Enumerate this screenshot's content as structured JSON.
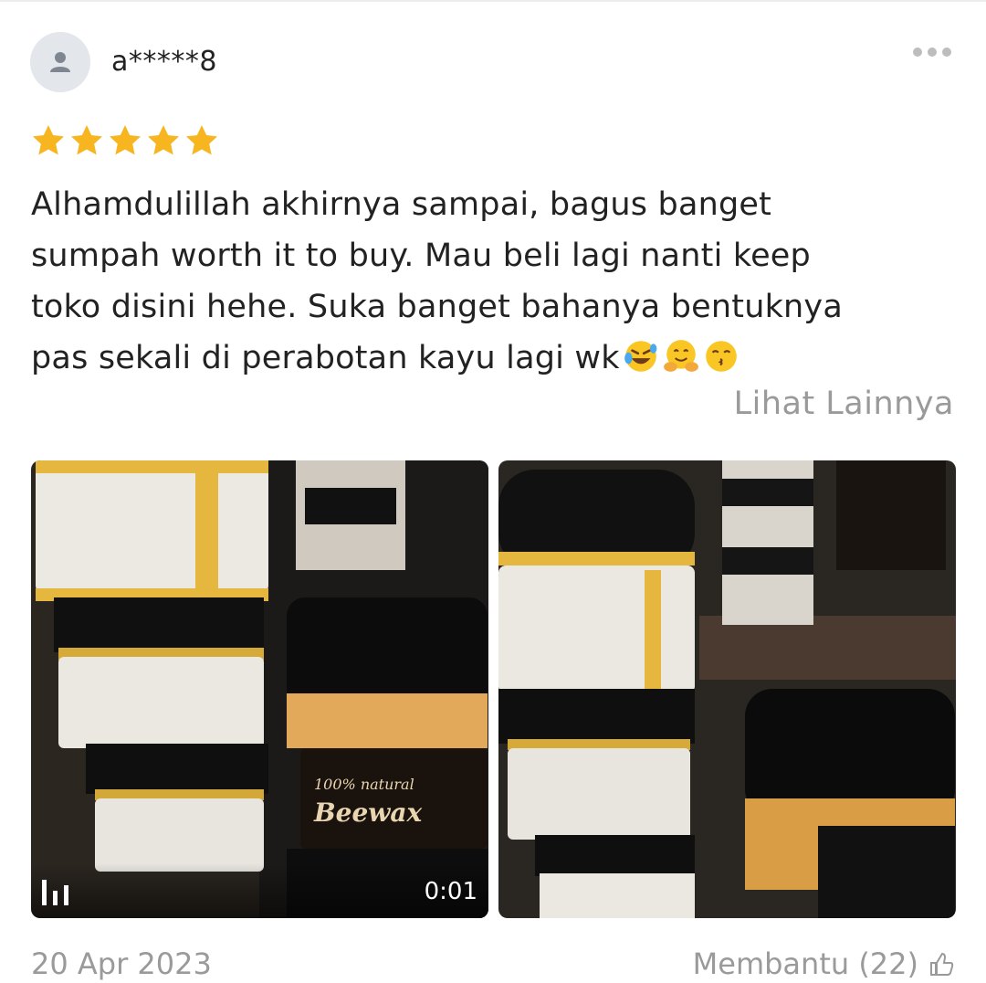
{
  "review": {
    "username": "a*****8",
    "rating": 5,
    "text_lines": [
      "Alhamdulillah akhirnya sampai, bagus banget",
      "sumpah worth it to buy. Mau beli lagi nanti keep",
      "toko disini hehe. Suka banget bahanya bentuknya",
      "pas sekali di perabotan kayu lagi wk"
    ],
    "emojis": [
      "rolling-on-floor-laughing",
      "hugging-face",
      "kissing-face-smiling-eyes"
    ],
    "see_more_label": "Lihat Lainnya",
    "media": [
      {
        "type": "video",
        "duration": "0:01",
        "label_on_product": "100% natural Beewax"
      },
      {
        "type": "photo"
      }
    ],
    "date": "20 Apr 2023",
    "helpful_label": "Membantu (22)"
  },
  "icons": {
    "avatar": "person-icon",
    "menu": "more-horizontal-icon",
    "star": "star-icon",
    "video": "video-bars-icon",
    "helpful": "thumbs-up-icon"
  },
  "colors": {
    "star": "#f7b51f",
    "muted_text": "#9a9a9a",
    "avatar_bg": "#e3e6ea"
  }
}
